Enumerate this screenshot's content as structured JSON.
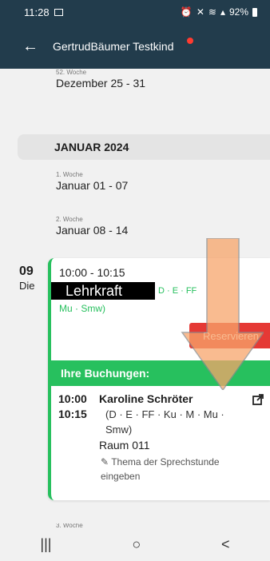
{
  "status": {
    "time": "11:28",
    "battery": "92%"
  },
  "app": {
    "title": "GertrudBäumer Testkind"
  },
  "weeks_before": [
    {
      "label": "52. Woche",
      "range": "Dezember 25 - 31"
    }
  ],
  "month": "JANUAR 2024",
  "weeks": [
    {
      "label": "1. Woche",
      "range": "Januar 01 - 07"
    },
    {
      "label": "2. Woche",
      "range": "Januar 08 - 14"
    }
  ],
  "day": {
    "num": "09",
    "name": "Die"
  },
  "slot": {
    "time": "10:00 - 10:15",
    "teacher": "Lehrkraft",
    "subjects_line1": "D · E · FF",
    "subjects_line2": "Mu · Smw)",
    "reserve_label": "Reservieren"
  },
  "bookings": {
    "header": "Ihre Buchungen:",
    "start": "10:00",
    "end": "10:15",
    "name": "Karoline Schröter",
    "subjects_line1": "(D · E · FF · Ku · M · Mu ·",
    "subjects_line2": "Smw)",
    "room": "Raum 011",
    "edit_line1": "Thema der Sprechstunde",
    "edit_line2": "eingeben"
  },
  "next_week_label": "3. Woche",
  "nav": {
    "recent": "|||",
    "home": "○",
    "back": "<"
  },
  "colors": {
    "appbar": "#223c4c",
    "accent": "#27c05e",
    "danger": "#e53935"
  }
}
